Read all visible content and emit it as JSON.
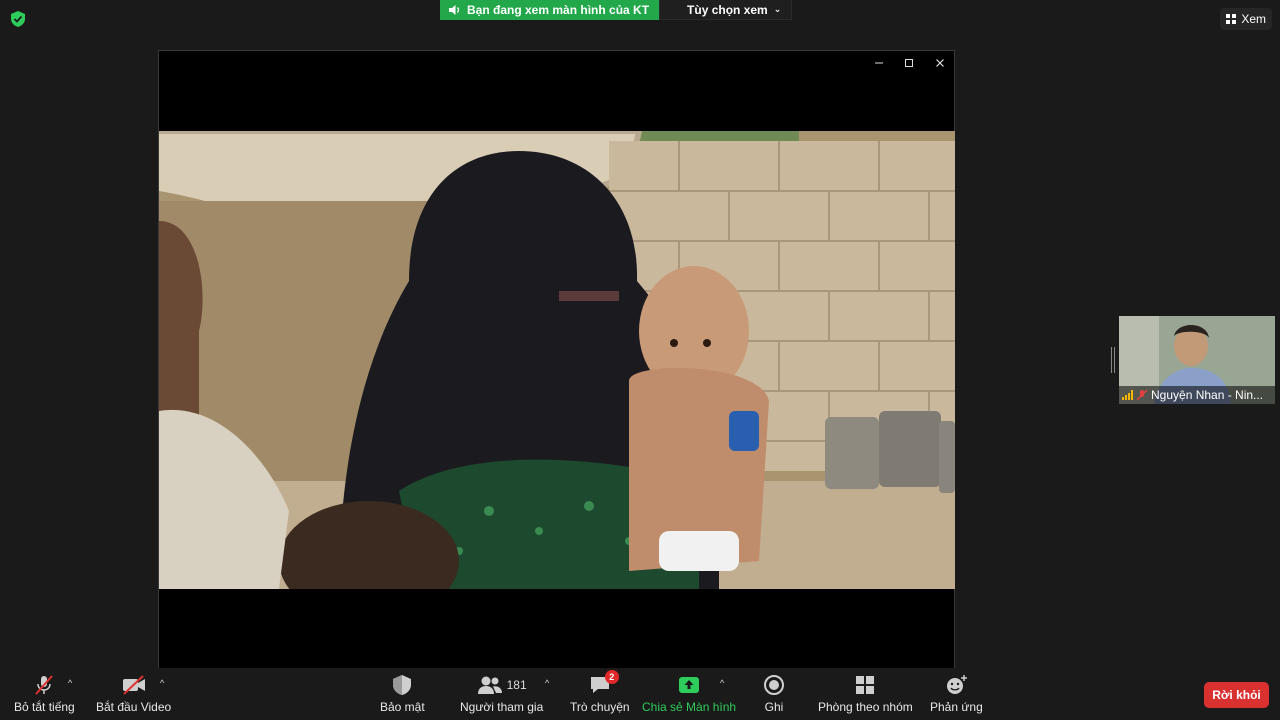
{
  "share_banner": {
    "status_text": "Bạn đang xem màn hình của KT",
    "view_options_label": "Tùy chọn xem"
  },
  "view_button_label": "Xem",
  "share_window": {
    "window_controls": [
      "minimize-icon",
      "maximize-icon",
      "close-icon"
    ]
  },
  "participant": {
    "name": "Nguyện Nhan - Nin..."
  },
  "toolbar": {
    "mute_label": "Bỏ tắt tiếng",
    "video_label": "Bắt đầu Video",
    "security_label": "Bảo mật",
    "participants_label": "Người tham gia",
    "participants_count": "181",
    "chat_label": "Trò chuyện",
    "chat_badge": "2",
    "share_label": "Chia sẻ Màn hình",
    "record_label": "Ghi",
    "breakout_label": "Phòng theo nhóm",
    "reactions_label": "Phản ứng",
    "leave_label": "Rời khỏi"
  },
  "colors": {
    "background": "#1a1a1a",
    "share_green": "#22a84a",
    "leave_red": "#d93030",
    "badge_red": "#e02828"
  }
}
